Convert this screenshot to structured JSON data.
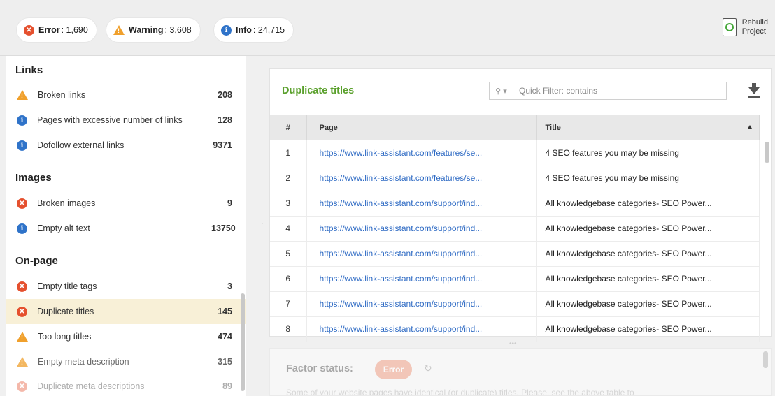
{
  "summary": {
    "error": {
      "label": "Error",
      "value": ": 1,690"
    },
    "warning": {
      "label": "Warning",
      "value": ": 3,608"
    },
    "info": {
      "label": "Info",
      "value": ": 24,715"
    }
  },
  "rebuild": {
    "line1": "Rebuild",
    "line2": "Project"
  },
  "sidebar": {
    "sections": [
      {
        "title": "Links"
      },
      {
        "title": "Images"
      },
      {
        "title": "On-page"
      }
    ],
    "items": [
      {
        "label": "Broken links",
        "count": "208",
        "status": "warning"
      },
      {
        "label": "Pages with excessive number of links",
        "count": "128",
        "status": "info"
      },
      {
        "label": "Dofollow external links",
        "count": "9371",
        "status": "info"
      },
      {
        "label": "Broken images",
        "count": "9",
        "status": "error"
      },
      {
        "label": "Empty alt text",
        "count": "13750",
        "status": "info"
      },
      {
        "label": "Empty title tags",
        "count": "3",
        "status": "error"
      },
      {
        "label": "Duplicate titles",
        "count": "145",
        "status": "error",
        "selected": true
      },
      {
        "label": "Too long titles",
        "count": "474",
        "status": "warning"
      },
      {
        "label": "Empty meta description",
        "count": "315",
        "status": "warning"
      },
      {
        "label": "Duplicate meta descriptions",
        "count": "89",
        "status": "error"
      }
    ]
  },
  "panel": {
    "title": "Duplicate titles",
    "filter_placeholder": "Quick Filter: contains",
    "columns": {
      "num": "#",
      "page": "Page",
      "title": "Title"
    },
    "rows": [
      {
        "num": "1",
        "page": "https://www.link-assistant.com/features/se...",
        "title": "4 SEO features you may be missing"
      },
      {
        "num": "2",
        "page": "https://www.link-assistant.com/features/se...",
        "title": "4 SEO features you may be missing"
      },
      {
        "num": "3",
        "page": "https://www.link-assistant.com/support/ind...",
        "title": "All knowledgebase categories- SEO Power..."
      },
      {
        "num": "4",
        "page": "https://www.link-assistant.com/support/ind...",
        "title": "All knowledgebase categories- SEO Power..."
      },
      {
        "num": "5",
        "page": "https://www.link-assistant.com/support/ind...",
        "title": "All knowledgebase categories- SEO Power..."
      },
      {
        "num": "6",
        "page": "https://www.link-assistant.com/support/ind...",
        "title": "All knowledgebase categories- SEO Power..."
      },
      {
        "num": "7",
        "page": "https://www.link-assistant.com/support/ind...",
        "title": "All knowledgebase categories- SEO Power..."
      },
      {
        "num": "8",
        "page": "https://www.link-assistant.com/support/ind...",
        "title": "All knowledgebase categories- SEO Power..."
      }
    ]
  },
  "factor": {
    "label": "Factor status:",
    "badge": "Error",
    "text": "Some of your website pages have identical (or duplicate) titles. Please, see the above table to"
  },
  "colors": {
    "error": "#e5502e",
    "warning": "#f0a02c",
    "info": "#2f73c9",
    "accent_green": "#5aa02c",
    "link": "#2f6bc4",
    "selected_row": "#f8f0d7"
  }
}
